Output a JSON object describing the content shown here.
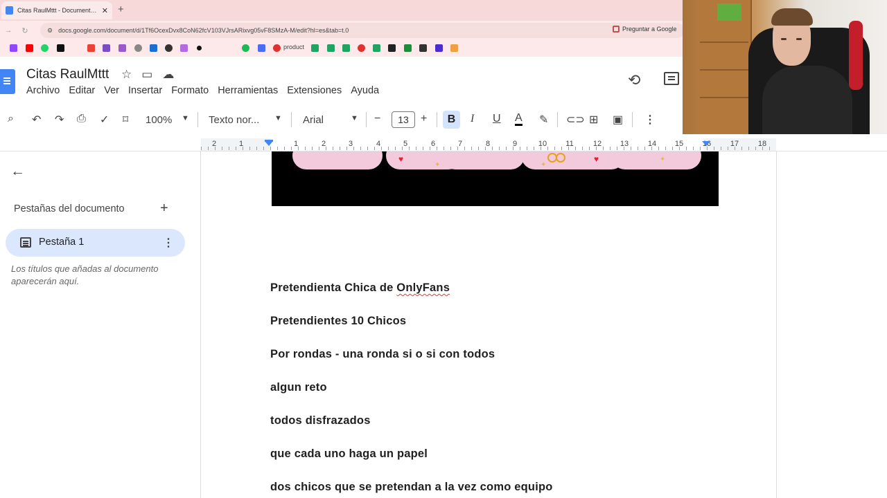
{
  "browser": {
    "tab_title": "Citas RaulMttt - Documentos de Google",
    "new_tab": "+",
    "tab_close": "✕",
    "url": "docs.google.com/document/d/1Tf6OcexDvx8CoN62fcV103VJrsARixvg05vF8SMzA-M/edit?hl=es&tab=t.0",
    "ask_google": "Preguntar a Google",
    "bookmark_text": "product"
  },
  "docs": {
    "title": "Citas RaulMttt",
    "menu": [
      "Archivo",
      "Editar",
      "Ver",
      "Insertar",
      "Formato",
      "Herramientas",
      "Extensiones",
      "Ayuda"
    ]
  },
  "toolbar": {
    "zoom": "100%",
    "style": "Texto nor...",
    "font": "Arial",
    "font_size": "13",
    "bold": "B",
    "italic": "I",
    "underline": "U",
    "text_color": "A"
  },
  "ruler": {
    "labels": [
      "2",
      "1",
      "1",
      "2",
      "3",
      "4",
      "5",
      "6",
      "7",
      "8",
      "9",
      "10",
      "11",
      "12",
      "13",
      "14",
      "15",
      "16",
      "17",
      "18"
    ]
  },
  "sidebar": {
    "heading": "Pestañas del documento",
    "tab_label": "Pestaña 1",
    "hint": "Los títulos que añadas al documento aparecerán aquí."
  },
  "document": {
    "line1_prefix": "Pretendienta Chica de ",
    "line1_spell": "OnlyFans",
    "paragraphs": [
      "Pretendientes  10 Chicos",
      "Por rondas - una ronda si o si con todos",
      "algun reto",
      "todos disfrazados",
      "que cada uno haga un papel",
      "dos chicos que se pretendan a la vez como equipo"
    ]
  },
  "colors": {
    "accent": "#4285f4",
    "bold_active": "#d3e3fd",
    "tab_pill": "#dbe7fd",
    "spellcheck": "#e53935"
  },
  "icons": [
    "docs-logo-icon",
    "star-icon",
    "move-folder-icon",
    "cloud-status-icon",
    "history-icon",
    "comments-icon",
    "search-icon",
    "undo-icon",
    "redo-icon",
    "print-icon",
    "spellcheck-icon",
    "paint-format-icon",
    "highlighter-icon",
    "link-icon",
    "add-comment-icon",
    "insert-image-icon",
    "more-icon",
    "back-arrow-icon",
    "add-tab-icon",
    "document-tab-icon",
    "more-options-icon"
  ]
}
